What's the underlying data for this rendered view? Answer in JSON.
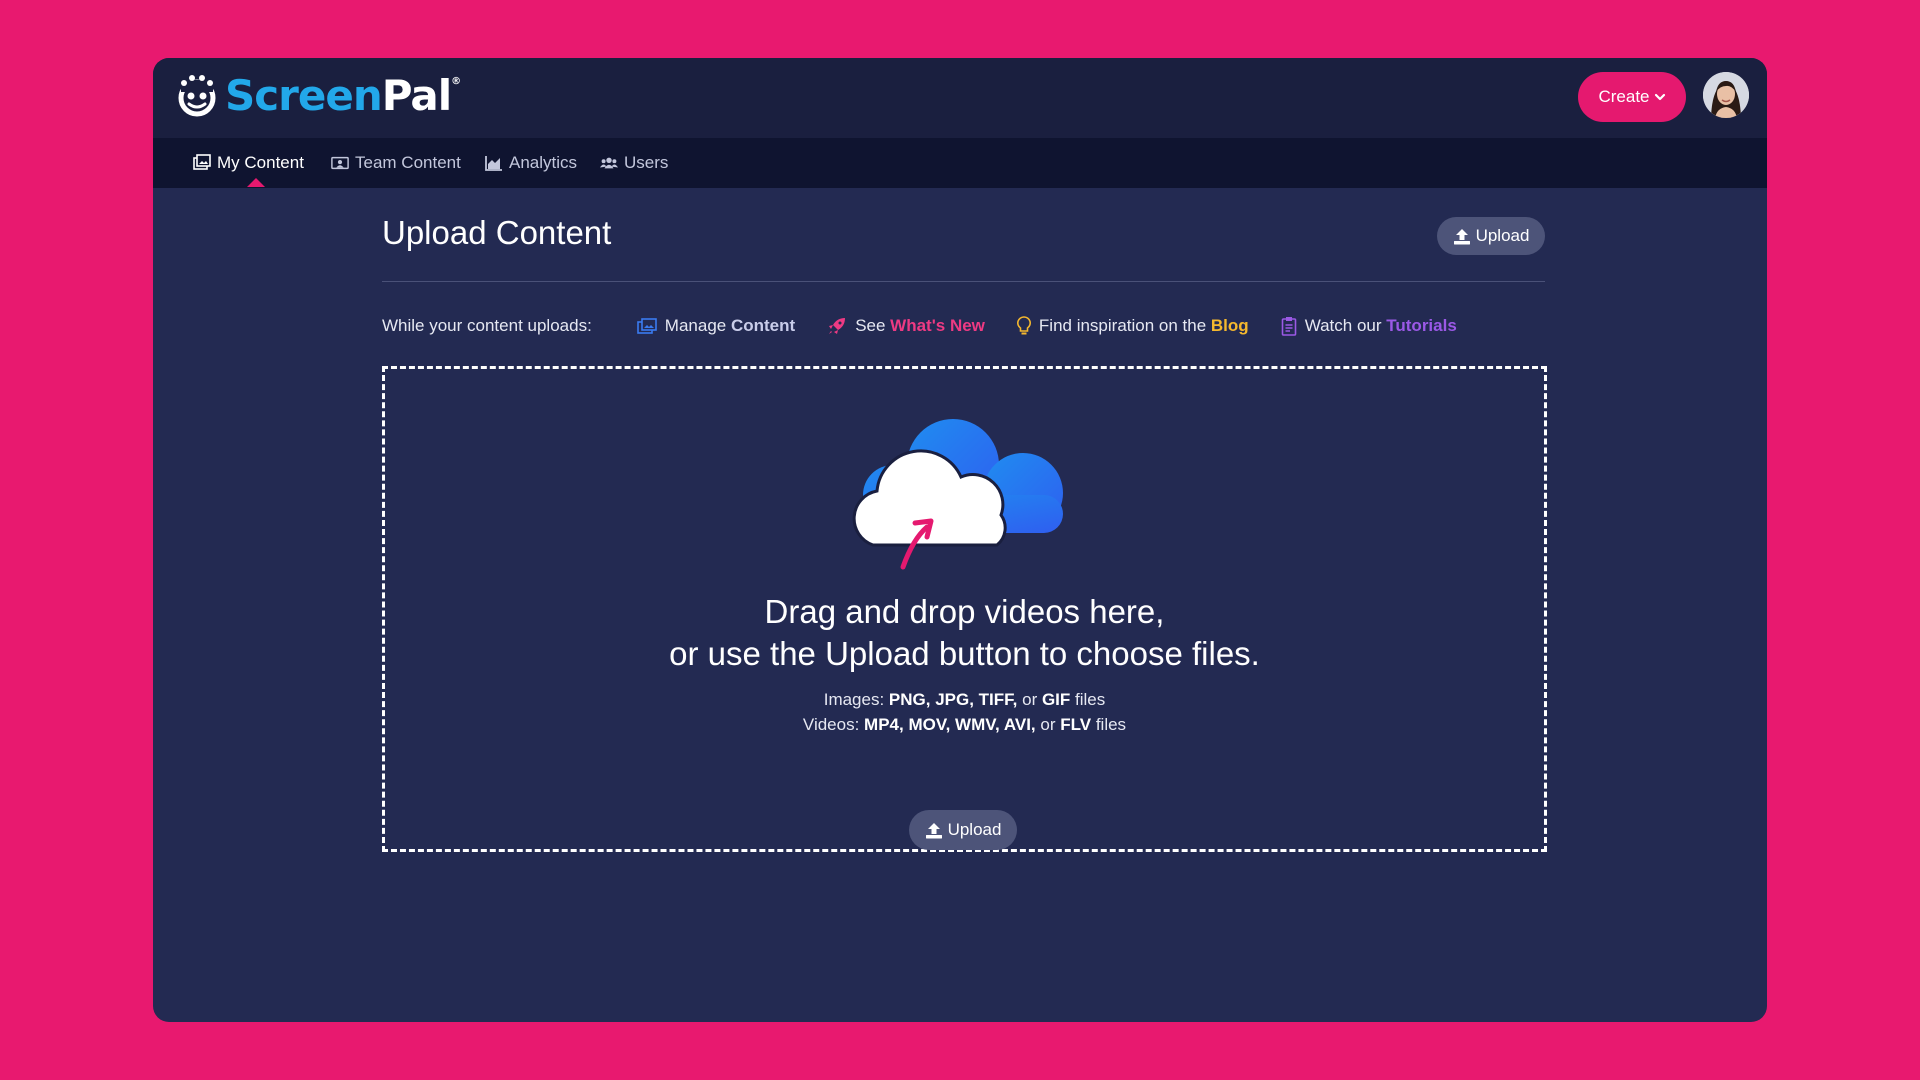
{
  "brand": {
    "name_part1": "Screen",
    "name_part2": "Pal",
    "mark": "®",
    "accent": "#22a8ea",
    "pink": "#e5196f"
  },
  "header": {
    "create_label": "Create",
    "create_icon": "chevron-down-icon",
    "avatar_icon": "user-avatar"
  },
  "nav": {
    "items": [
      {
        "label": "My Content",
        "icon": "my-content-icon",
        "active": true
      },
      {
        "label": "Team Content",
        "icon": "team-content-icon",
        "active": false
      },
      {
        "label": "Analytics",
        "icon": "analytics-icon",
        "active": false
      },
      {
        "label": "Users",
        "icon": "users-icon",
        "active": false
      }
    ]
  },
  "page": {
    "title": "Upload Content",
    "upload_label": "Upload"
  },
  "uploads_bar": {
    "lead": "While your content uploads:",
    "tips": [
      {
        "prefix": "Manage ",
        "highlight": "Content",
        "color": "#c9cdea",
        "icon": "manage-content-icon"
      },
      {
        "prefix": "See ",
        "highlight": "What's New",
        "color": "#ee3a83",
        "icon": "rocket-icon"
      },
      {
        "prefix": "Find inspiration on the ",
        "highlight": "Blog",
        "color": "#f5b82e",
        "icon": "lightbulb-icon"
      },
      {
        "prefix": "Watch our ",
        "highlight": "Tutorials",
        "color": "#9b59e6",
        "icon": "clipboard-icon"
      }
    ]
  },
  "dropzone": {
    "line1": "Drag and drop videos here,",
    "line2": "or use the Upload button to choose files.",
    "images_prefix": "Images: ",
    "images_types": "PNG, JPG, TIFF,",
    "images_or": " or ",
    "images_last": "GIF",
    "images_suffix": " files",
    "videos_prefix": "Videos: ",
    "videos_types": "MP4, MOV, WMV, AVI,",
    "videos_or": " or ",
    "videos_last": "FLV",
    "videos_suffix": " files",
    "upload_label": "Upload"
  }
}
